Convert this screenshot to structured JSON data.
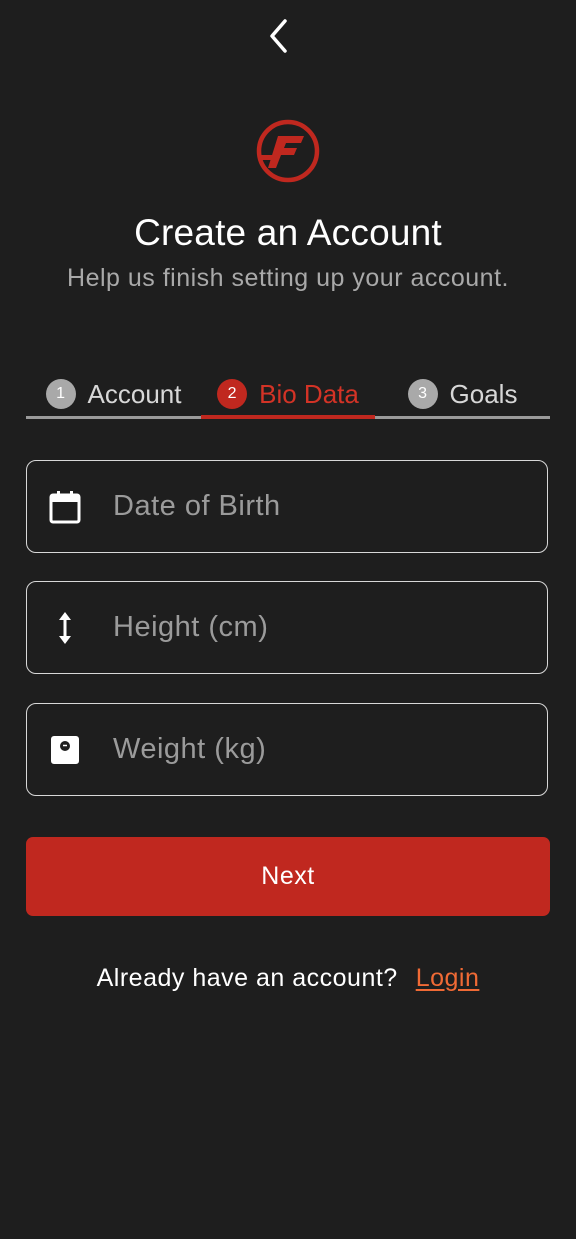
{
  "header": {
    "title": "Create an Account",
    "subtitle": "Help us finish setting up your account."
  },
  "stepper": {
    "steps": [
      {
        "number": "1",
        "label": "Account",
        "state": "inactive"
      },
      {
        "number": "2",
        "label": "Bio Data",
        "state": "active"
      },
      {
        "number": "3",
        "label": "Goals",
        "state": "inactive"
      }
    ]
  },
  "form": {
    "dob": {
      "placeholder": "Date of Birth",
      "value": "",
      "icon": "calendar-icon"
    },
    "height": {
      "placeholder": "Height (cm)",
      "value": "",
      "icon": "vertical-arrows-icon"
    },
    "weight": {
      "placeholder": "Weight (kg)",
      "value": "",
      "icon": "scale-icon"
    }
  },
  "actions": {
    "next_label": "Next"
  },
  "footer": {
    "prompt": "Already have an account?",
    "login_label": "Login"
  },
  "colors": {
    "background": "#1e1e1e",
    "accent": "#c0281f",
    "link": "#f06a35"
  }
}
